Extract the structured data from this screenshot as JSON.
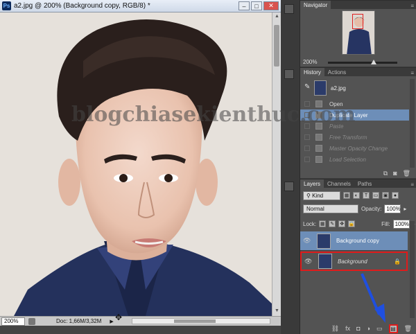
{
  "document": {
    "ps_logo": "Ps",
    "title": "a2.jpg @ 200% (Background copy, RGB/8) *",
    "zoom": "200%",
    "doc_size": "Doc: 1,66M/3,32M"
  },
  "watermark": "blogchiasekienthuc.com",
  "navigator": {
    "tab": "Navigator",
    "zoom": "200%"
  },
  "history": {
    "tabs": [
      "History",
      "Actions"
    ],
    "snapshot_label": "a2.jpg",
    "items": [
      {
        "label": "Open",
        "state": "normal"
      },
      {
        "label": "Duplicate Layer",
        "state": "active"
      },
      {
        "label": "Paste",
        "state": "dim"
      },
      {
        "label": "Free Transform",
        "state": "dim"
      },
      {
        "label": "Master Opacity Change",
        "state": "dim"
      },
      {
        "label": "Load Selection",
        "state": "dim"
      }
    ]
  },
  "layers": {
    "tabs": [
      "Layers",
      "Channels",
      "Paths"
    ],
    "kind_label": "Kind",
    "blend_mode": "Normal",
    "opacity_label": "Opacity:",
    "opacity": "100%",
    "lock_label": "Lock:",
    "fill_label": "Fill:",
    "fill": "100%",
    "items": [
      {
        "name": "Background copy",
        "state": "active"
      },
      {
        "name": "Background",
        "state": "highlighted"
      }
    ]
  },
  "colors": {
    "accent_selection": "#6d8eb8",
    "highlight_red": "#e01b1b",
    "arrow_blue": "#1f4fe0"
  }
}
